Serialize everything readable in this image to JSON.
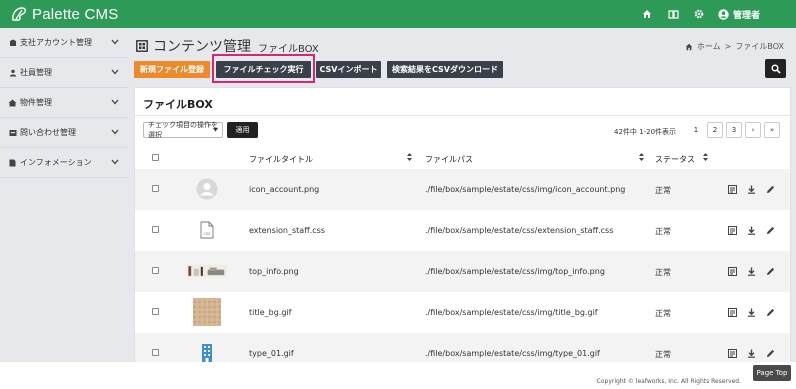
{
  "header": {
    "logo_text": "Palette CMS",
    "icons": [
      "home-icon",
      "book-icon",
      "gear-icon"
    ],
    "user_label": "管理者",
    "colors": {
      "bar": "#2e9a57"
    }
  },
  "sidebar": {
    "items": [
      {
        "label": "支社アカウント管理",
        "icon": "building-icon"
      },
      {
        "label": "社員管理",
        "icon": "people-icon"
      },
      {
        "label": "物件管理",
        "icon": "house-icon"
      },
      {
        "label": "問い合わせ管理",
        "icon": "inbox-icon"
      },
      {
        "label": "インフォメーション",
        "icon": "document-icon"
      }
    ]
  },
  "page": {
    "title": "コンテンツ管理",
    "subtitle": "ファイルBOX",
    "breadcrumb": {
      "home": "ホーム",
      "separator": ">",
      "current": "ファイルBOX"
    }
  },
  "toolbar": {
    "new_file": "新規ファイル登録",
    "file_check": "ファイルチェック実行",
    "csv_import": "CSVインポート",
    "csv_download": "検索結果をCSVダウンロード"
  },
  "card": {
    "title": "ファイルBOX",
    "bulk_select_label": "チェック項目の操作を選択",
    "apply_label": "適用",
    "count_text": "42件中 1-20件表示",
    "pagination": [
      "1",
      "2",
      "3",
      "›",
      "»"
    ],
    "columns": {
      "title": "ファイルタイトル",
      "path": "ファイルパス",
      "status": "ステータス"
    }
  },
  "rows": [
    {
      "title": "icon_account.png",
      "path": "./file/box/sample/estate/css/img/icon_account.png",
      "status": "正常",
      "thumb": "avatar-thumbnail"
    },
    {
      "title": "extension_staff.css",
      "path": "./file/box/sample/estate/css/extension_staff.css",
      "status": "正常",
      "thumb": "css-file-thumbnail"
    },
    {
      "title": "top_info.png",
      "path": "./file/box/sample/estate/css/img/top_info.png",
      "status": "正常",
      "thumb": "interior-photo-thumbnail"
    },
    {
      "title": "title_bg.gif",
      "path": "./file/box/sample/estate/css/img/title_bg.gif",
      "status": "正常",
      "thumb": "fabric-texture-thumbnail"
    },
    {
      "title": "type_01.gif",
      "path": "./file/box/sample/estate/css/img/type_01.gif",
      "status": "正常",
      "thumb": "building-thumbnail"
    }
  ],
  "footer": {
    "copyright": "Copyright © leafworks, Inc. All Rights Reserved.",
    "page_top": "Page Top"
  }
}
